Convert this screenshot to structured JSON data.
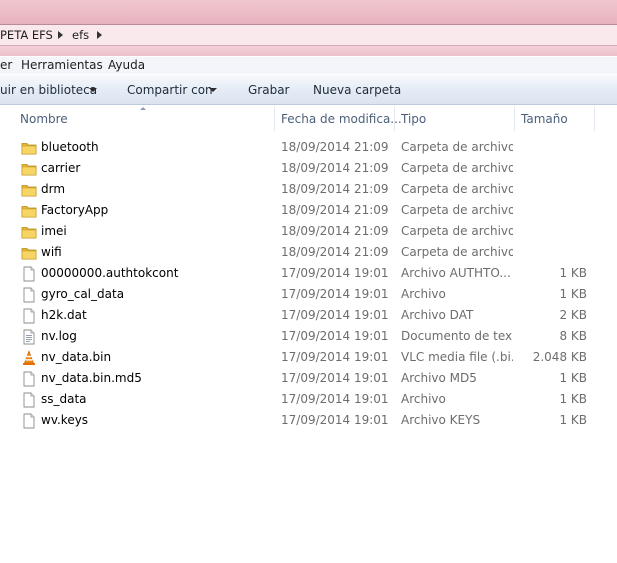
{
  "address": {
    "crumbs": [
      "PETA EFS",
      "efs"
    ]
  },
  "menubar": {
    "items": [
      "er",
      "Herramientas",
      "Ayuda"
    ]
  },
  "toolbar": {
    "include_library": "uir en biblioteca",
    "share_with": "Compartir con",
    "burn": "Grabar",
    "new_folder": "Nueva carpeta"
  },
  "columns": {
    "name": "Nombre",
    "date": "Fecha de modifica...",
    "type": "Tipo",
    "size": "Tamaño"
  },
  "files": [
    {
      "name": "bluetooth",
      "date": "18/09/2014 21:09",
      "type": "Carpeta de archivos",
      "size": "",
      "icon": "folder-icon"
    },
    {
      "name": "carrier",
      "date": "18/09/2014 21:09",
      "type": "Carpeta de archivos",
      "size": "",
      "icon": "folder-icon"
    },
    {
      "name": "drm",
      "date": "18/09/2014 21:09",
      "type": "Carpeta de archivos",
      "size": "",
      "icon": "folder-icon"
    },
    {
      "name": "FactoryApp",
      "date": "18/09/2014 21:09",
      "type": "Carpeta de archivos",
      "size": "",
      "icon": "folder-icon"
    },
    {
      "name": "imei",
      "date": "18/09/2014 21:09",
      "type": "Carpeta de archivos",
      "size": "",
      "icon": "folder-icon"
    },
    {
      "name": "wifi",
      "date": "18/09/2014 21:09",
      "type": "Carpeta de archivos",
      "size": "",
      "icon": "folder-icon"
    },
    {
      "name": "00000000.authtokcont",
      "date": "17/09/2014 19:01",
      "type": "Archivo AUTHTO...",
      "size": "1 KB",
      "icon": "file-icon"
    },
    {
      "name": "gyro_cal_data",
      "date": "17/09/2014 19:01",
      "type": "Archivo",
      "size": "1 KB",
      "icon": "file-icon"
    },
    {
      "name": "h2k.dat",
      "date": "17/09/2014 19:01",
      "type": "Archivo DAT",
      "size": "2 KB",
      "icon": "file-icon"
    },
    {
      "name": "nv.log",
      "date": "17/09/2014 19:01",
      "type": "Documento de tex...",
      "size": "8 KB",
      "icon": "text-file-icon"
    },
    {
      "name": "nv_data.bin",
      "date": "17/09/2014 19:01",
      "type": "VLC media file (.bi...",
      "size": "2.048 KB",
      "icon": "vlc-icon"
    },
    {
      "name": "nv_data.bin.md5",
      "date": "17/09/2014 19:01",
      "type": "Archivo MD5",
      "size": "1 KB",
      "icon": "file-icon"
    },
    {
      "name": "ss_data",
      "date": "17/09/2014 19:01",
      "type": "Archivo",
      "size": "1 KB",
      "icon": "file-icon"
    },
    {
      "name": "wv.keys",
      "date": "17/09/2014 19:01",
      "type": "Archivo KEYS",
      "size": "1 KB",
      "icon": "file-icon"
    }
  ]
}
